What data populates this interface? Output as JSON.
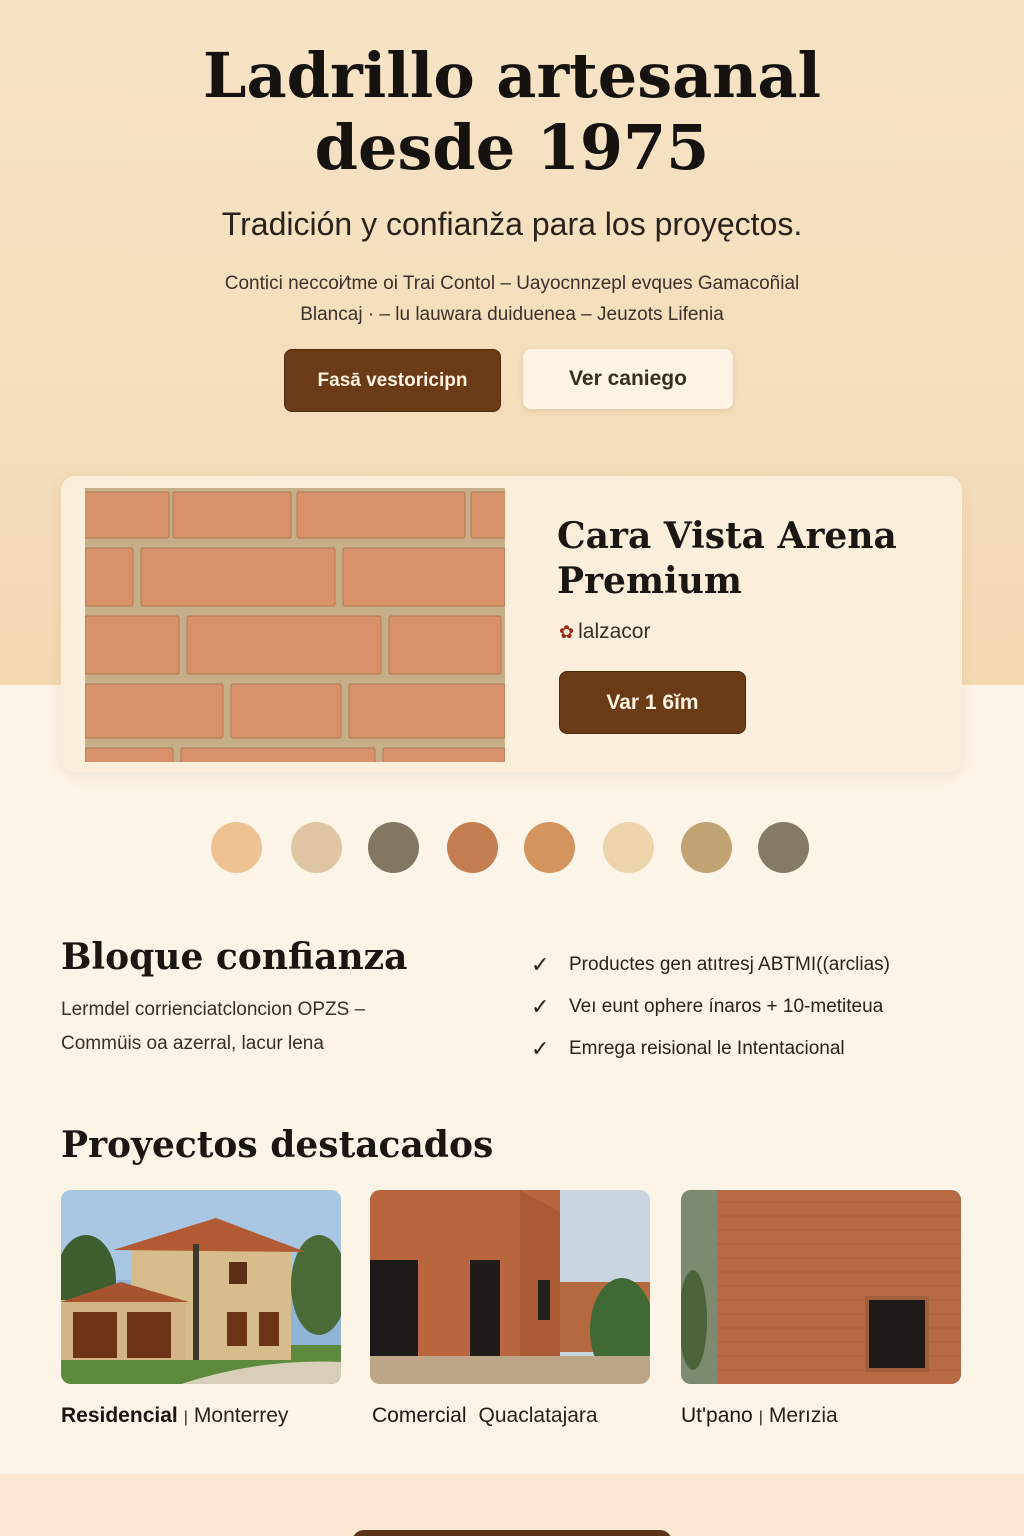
{
  "hero": {
    "title_line1": "Ladrillo artesanal",
    "title_line2": "desde 1975",
    "subtitle": "Tradición y confianža para los proyęctos.",
    "desc_line1": "Contici neccoi⁄tme oi Trai Contol  – Uayocnnzepl evques  Gamacoñial",
    "desc_line2": "Blancaj · – lu lauwara duiduenea  –  Jeuzots Lifenia",
    "primary_button": "Fasā vestoricipn",
    "secondary_button": "Ver caniego"
  },
  "product": {
    "name_line1": "Cara Vista Arena",
    "name_line2": "Premium",
    "maker": "lalzacor",
    "maker_icon": "flame-icon",
    "spec_button": "Var 1 6ĭm"
  },
  "swatches": [
    "#eec391",
    "#dfc5a2",
    "#847762",
    "#c47d50",
    "#d4945e",
    "#edd4ad",
    "#c2a374",
    "#857b65"
  ],
  "trust": {
    "title": "Bloque confianza",
    "text_line1": "Lermdel corrienciatcloncion OPZS –",
    "text_line2": "Commüis oa azerral, lacur lena",
    "checks": [
      "Productes gen atıtresj ABTMI((arclias)",
      "Veı eunt ophere ínaros  + 10-metiteua",
      "Emrega reisional le Intentacional"
    ]
  },
  "projects": {
    "title": "Proyectos destacados",
    "items": [
      {
        "category": "Residencial",
        "separator": "|",
        "city": "Monterrey"
      },
      {
        "category": "Comercial",
        "separator": "",
        "city": "Quaclatajara"
      },
      {
        "category": "Ut'pano",
        "separator": "|",
        "city": "Merızia"
      }
    ]
  },
  "colors": {
    "accent": "#6b3a16",
    "hero_bg": "#f3d9b2",
    "page_bg": "#fcf4e6"
  }
}
